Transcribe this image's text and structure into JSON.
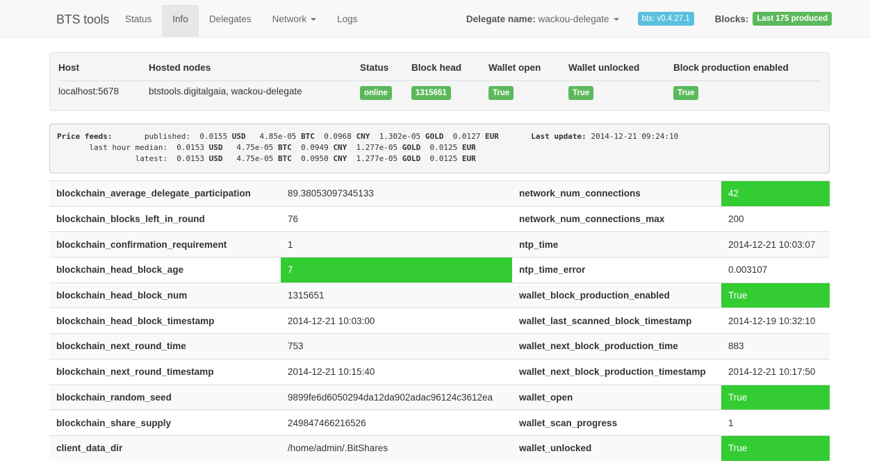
{
  "navbar": {
    "brand": "BTS tools",
    "items": [
      "Status",
      "Info",
      "Delegates",
      "Network",
      "Logs"
    ],
    "active": "Info",
    "delegate_label": "Delegate name:",
    "delegate_value": "wackou-delegate",
    "version_badge": "bts: v0.4.27.1",
    "blocks_label": "Blocks:",
    "blocks_badge": "Last 175 produced"
  },
  "host_table": {
    "headers": [
      "Host",
      "Hosted nodes",
      "Status",
      "Block head",
      "Wallet open",
      "Wallet unlocked",
      "Block production enabled"
    ],
    "row": {
      "host": "localhost:5678",
      "hosted_nodes": "btstools.digitalgaia, wackou-delegate",
      "status": "online",
      "block_head": "1315651",
      "wallet_open": "True",
      "wallet_unlocked": "True",
      "block_production_enabled": "True"
    }
  },
  "price_feeds": {
    "title": "Price feeds:",
    "rows": [
      {
        "label": "published:",
        "usd": "0.0155",
        "btc": "4.85e-05",
        "cny": "0.0968",
        "gold": "1.302e-05",
        "eur": "0.0127"
      },
      {
        "label": "last hour median:",
        "usd": "0.0153",
        "btc": "4.75e-05",
        "cny": "0.0949",
        "gold": "1.277e-05",
        "eur": "0.0125"
      },
      {
        "label": "latest:",
        "usd": "0.0153",
        "btc": "4.75e-05",
        "cny": "0.0950",
        "gold": "1.277e-05",
        "eur": "0.0125"
      }
    ],
    "units": {
      "usd": "USD",
      "btc": "BTC",
      "cny": "CNY",
      "gold": "GOLD",
      "eur": "EUR"
    },
    "last_update_label": "Last update:",
    "last_update": "2014-12-21 09:24:10"
  },
  "stats": [
    {
      "k1": "blockchain_average_delegate_participation",
      "v1": "89.38053097345133",
      "k2": "network_num_connections",
      "v2": "42"
    },
    {
      "k1": "blockchain_blocks_left_in_round",
      "v1": "76",
      "k2": "network_num_connections_max",
      "v2": "200"
    },
    {
      "k1": "blockchain_confirmation_requirement",
      "v1": "1",
      "k2": "ntp_time",
      "v2": "2014-12-21 10:03:07"
    },
    {
      "k1": "blockchain_head_block_age",
      "v1": "7",
      "k2": "ntp_time_error",
      "v2": "0.003107"
    },
    {
      "k1": "blockchain_head_block_num",
      "v1": "1315651",
      "k2": "wallet_block_production_enabled",
      "v2": "True"
    },
    {
      "k1": "blockchain_head_block_timestamp",
      "v1": "2014-12-21 10:03:00",
      "k2": "wallet_last_scanned_block_timestamp",
      "v2": "2014-12-19 10:32:10"
    },
    {
      "k1": "blockchain_next_round_time",
      "v1": "753",
      "k2": "wallet_next_block_production_time",
      "v2": "883"
    },
    {
      "k1": "blockchain_next_round_timestamp",
      "v1": "2014-12-21 10:15:40",
      "k2": "wallet_next_block_production_timestamp",
      "v2": "2014-12-21 10:17:50"
    },
    {
      "k1": "blockchain_random_seed",
      "v1": "9899fe6d6050294da12da902adac96124c3612ea",
      "k2": "wallet_open",
      "v2": "True"
    },
    {
      "k1": "blockchain_share_supply",
      "v1": "249847466216526",
      "k2": "wallet_scan_progress",
      "v2": "1"
    },
    {
      "k1": "client_data_dir",
      "v1": "/home/admin/.BitShares",
      "k2": "wallet_unlocked",
      "v2": "True"
    }
  ],
  "colors": {
    "good": "#33cc33",
    "label_success": "#5cb85c",
    "label_info": "#5bc0de"
  }
}
